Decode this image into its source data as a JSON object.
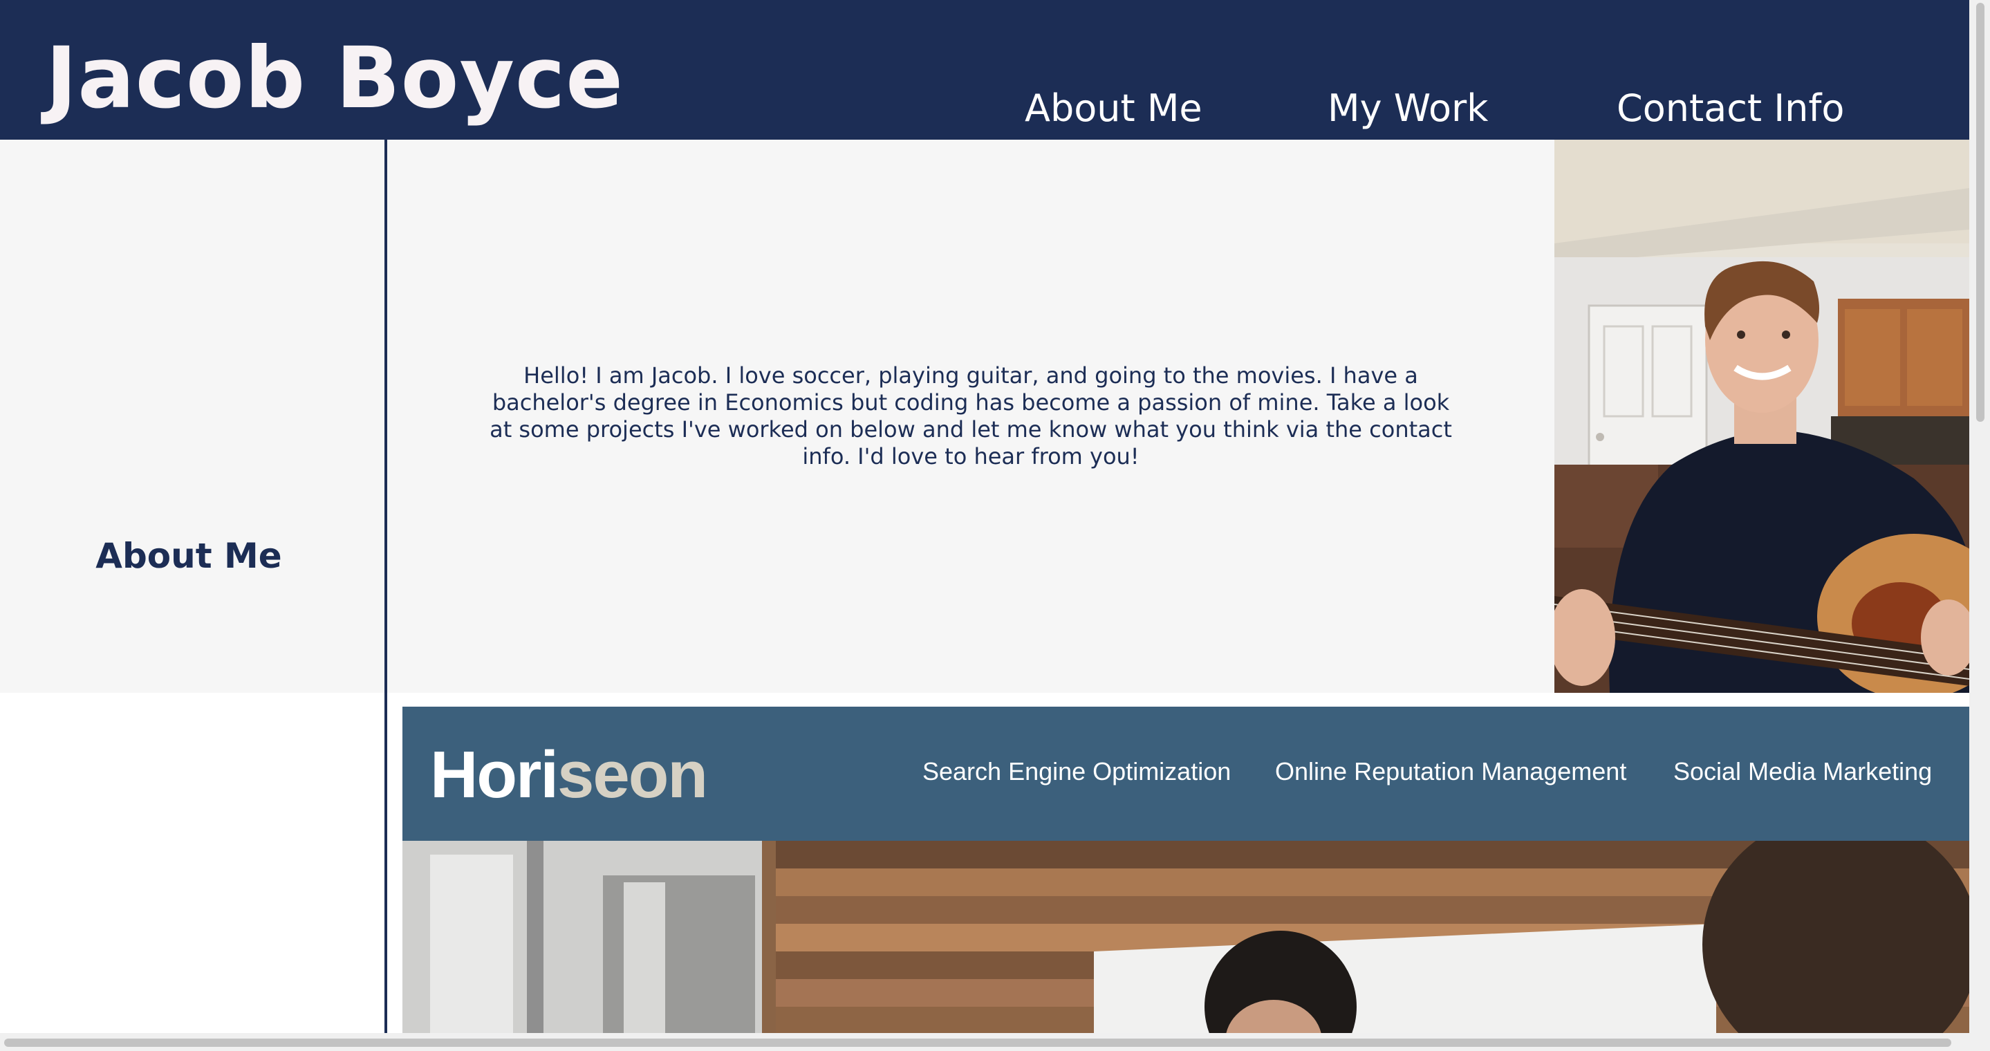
{
  "header": {
    "title": "Jacob Boyce",
    "nav": [
      {
        "label": "About Me"
      },
      {
        "label": "My Work"
      },
      {
        "label": "Contact Info"
      }
    ]
  },
  "about": {
    "heading": "About Me",
    "body": "Hello! I am Jacob. I love soccer, playing guitar, and going to the movies. I have a bachelor's degree in Economics but coding has become a passion of mine. Take a look at some projects I've worked on below and let me know what you think via the contact info. I'd love to hear from you!"
  },
  "project": {
    "logo_part1": "Hori",
    "logo_part2": "seon",
    "nav": [
      {
        "label": "Search Engine Optimization"
      },
      {
        "label": "Online Reputation Management"
      },
      {
        "label": "Social Media Marketing"
      }
    ]
  },
  "colors": {
    "header_bg": "#1c2d55",
    "section_bg": "#f6f6f6",
    "project_header_bg": "#3c607c"
  }
}
